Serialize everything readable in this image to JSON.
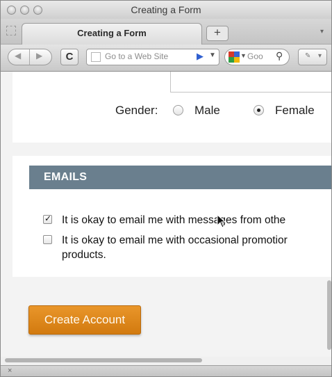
{
  "window": {
    "title": "Creating a Form"
  },
  "tabs": [
    {
      "label": "Creating a Form",
      "active": true
    }
  ],
  "new_tab_label": "+",
  "toolbar": {
    "reload_icon": "reload-icon",
    "address_placeholder": "Go to a Web Site",
    "search_placeholder": "Goo"
  },
  "form": {
    "gender": {
      "label": "Gender:",
      "options": [
        {
          "label": "Male",
          "selected": false
        },
        {
          "label": "Female",
          "selected": true
        }
      ]
    },
    "emails_section": {
      "heading": "EMAILS",
      "checkboxes": [
        {
          "label": "It is okay to email me with messages from othe",
          "checked": true
        },
        {
          "label_line1": "It is okay to email me with occasional promotior",
          "label_line2": "products.",
          "checked": false
        }
      ]
    },
    "submit_label": "Create Account"
  },
  "statusbar": {
    "close_label": "×"
  },
  "colors": {
    "section_header": "#6a7f8e",
    "button": "#e08a1e",
    "page_bg": "#f3f3f3"
  }
}
